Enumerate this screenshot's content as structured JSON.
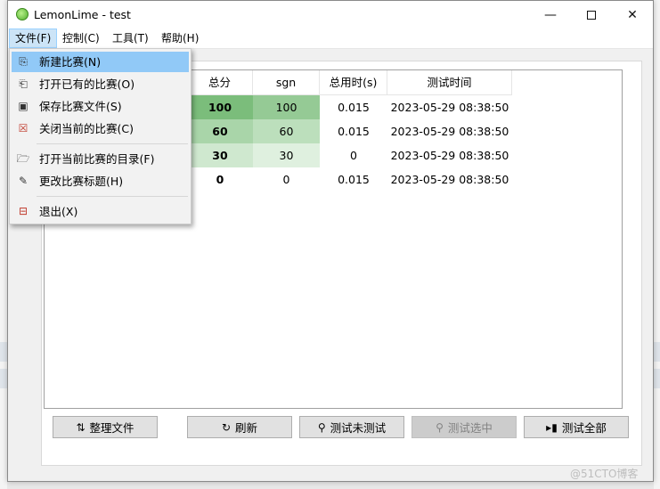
{
  "window": {
    "title": "LemonLime - test"
  },
  "menubar": {
    "items": [
      "文件(F)",
      "控制(C)",
      "工具(T)",
      "帮助(H)"
    ]
  },
  "file_menu": {
    "items": [
      {
        "label": "新建比赛(N)",
        "icon": "new-contest-icon"
      },
      {
        "label": "打开已有的比赛(O)",
        "icon": "open-contest-icon"
      },
      {
        "label": "保存比赛文件(S)",
        "icon": "save-icon"
      },
      {
        "label": "关闭当前的比赛(C)",
        "icon": "close-contest-icon"
      },
      {
        "label": "打开当前比赛的目录(F)",
        "icon": "open-folder-icon"
      },
      {
        "label": "更改比赛标题(H)",
        "icon": "edit-icon"
      },
      {
        "label": "退出(X)",
        "icon": "exit-icon"
      }
    ]
  },
  "results_table": {
    "headers": [
      "总分",
      "sgn",
      "总用时(s)",
      "测试时间"
    ],
    "rows": [
      {
        "total": "100",
        "sgn": "100",
        "time": "0.015",
        "tested": "2023-05-29 08:38:50"
      },
      {
        "total": "60",
        "sgn": "60",
        "time": "0.015",
        "tested": "2023-05-29 08:38:50"
      },
      {
        "total": "30",
        "sgn": "30",
        "time": "0",
        "tested": "2023-05-29 08:38:50"
      },
      {
        "total": "0",
        "sgn": "0",
        "time": "0.015",
        "tested": "2023-05-29 08:38:50"
      }
    ],
    "score_colors": [
      "#7bbd7b",
      "#a9d5a9",
      "#cfe8cf",
      "#ffffff"
    ],
    "sgn_colors": [
      "#95ca95",
      "#bcdfbc",
      "#dff0df",
      "#ffffff"
    ]
  },
  "buttons": {
    "organize": "整理文件",
    "refresh": "刷新",
    "test_untested": "测试未测试",
    "test_selected": "测试选中",
    "test_all": "测试全部"
  },
  "watermark": "@51CTO博客"
}
